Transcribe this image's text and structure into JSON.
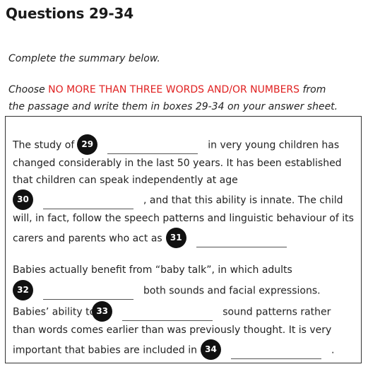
{
  "page_title": "Questions 29-34",
  "instructions": {
    "line1": "Complete the summary below.",
    "line2_pre": "Choose ",
    "line2_red": "NO MORE THAN THREE WORDS AND/OR NUMBERS",
    "line2_post": " from",
    "line3": "the passage and write them in boxes 29-34 on your answer sheet."
  },
  "summary": {
    "p1_l1_pre": "The study of",
    "p1_l1_post": "in very young children has",
    "p1_l2": "changed considerably in the last 50 years. It has been established",
    "p1_l3": "that children can speak independently at age",
    "p1_l4_post": ", and that this ability is innate. The child",
    "p1_l5": "will, in fact, follow the speech patterns and linguistic behaviour of its",
    "p1_l6_pre": "carers and parents who act as",
    "p2_l1": "Babies actually benefit from “baby talk”, in which adults",
    "p2_l2_post": "both sounds and facial expressions.",
    "p2_l3_pre": "Babies’ ability to",
    "p2_l3_post": "sound patterns rather",
    "p2_l4": "than words comes earlier than was previously thought. It is very",
    "p2_l5_pre": "important that babies are included in",
    "p2_l5_post": "."
  },
  "questions": [
    "29",
    "30",
    "31",
    "32",
    "33",
    "34"
  ],
  "colors": {
    "accent_red": "#e02020",
    "number_badge": "#111111"
  }
}
